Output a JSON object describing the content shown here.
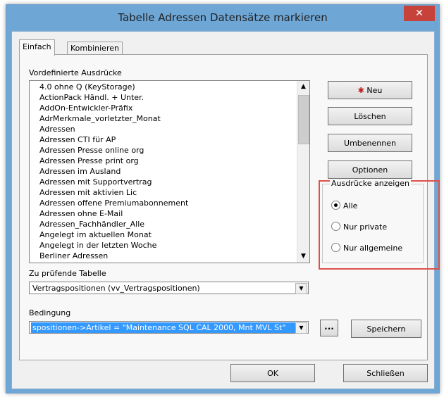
{
  "window": {
    "title": "Tabelle Adressen Datensätze markieren",
    "close_glyph": "✕"
  },
  "tabs": [
    {
      "label": "Einfach",
      "active": true
    },
    {
      "label": "Kombinieren",
      "active": false
    }
  ],
  "predefined": {
    "label": "Vordefinierte Ausdrücke",
    "items": [
      "4.0 ohne Q (KeyStorage)",
      "ActionPack Händl. + Unter.",
      "AddOn-Entwickler-Präfix",
      "AdrMerkmale_vorletzter_Monat",
      "Adressen",
      "Adressen CTI für AP",
      "Adressen Presse online org",
      "Adressen Presse print org",
      "Adressen im Ausland",
      "Adressen mit Supportvertrag",
      "Adressen mit aktivien Lic",
      "Adressen offene Premiumabonnement",
      "Adressen ohne E-Mail",
      "Adressen_Fachhändler_Alle",
      "Angelegt im aktuellen Monat",
      "Angelegt in der letzten Woche",
      "Berliner Adressen"
    ]
  },
  "side_buttons": {
    "new_label": "Neu",
    "delete_label": "Löschen",
    "rename_label": "Umbenennen",
    "options_label": "Optionen"
  },
  "show_group": {
    "title": "Ausdrücke anzeigen",
    "options": [
      {
        "label": "Alle",
        "selected": true
      },
      {
        "label": "Nur private",
        "selected": false
      },
      {
        "label": "Nur allgemeine",
        "selected": false
      }
    ]
  },
  "table": {
    "label": "Zu prüfende Tabelle",
    "value": "Vertragspositionen (vv_Vertragspositionen)"
  },
  "condition": {
    "label": "Bedingung",
    "value": "spositionen->Artikel = \"Maintenance SQL CAL 2000, Mnt MVL St\"",
    "ellipsis_label": "...",
    "save_label": "Speichern"
  },
  "footer": {
    "ok_label": "OK",
    "close_label": "Schließen"
  },
  "colors": {
    "titlebar": "#6ea6d6",
    "close": "#c7423a",
    "highlight": "#e0504a",
    "selection": "#3399ff"
  }
}
